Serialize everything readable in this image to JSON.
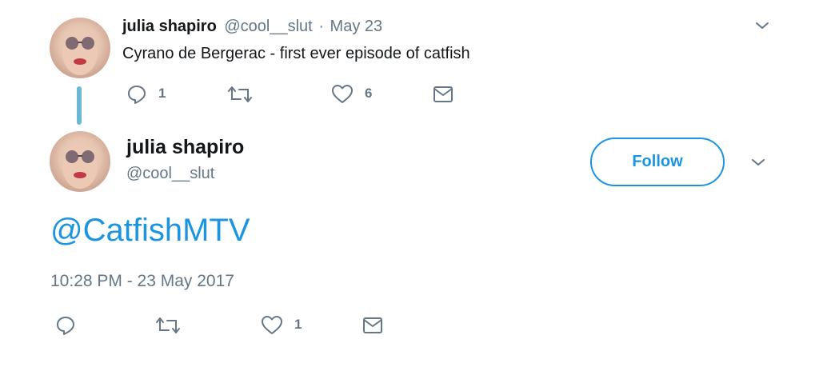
{
  "reply_tweet": {
    "author_name": "julia shapiro",
    "handle": "@cool__slut",
    "separator": "·",
    "date": "May 23",
    "text": "Cyrano de Bergerac - first ever episode of catfish",
    "reply_count": "1",
    "like_count": "6",
    "icons": [
      "reply-icon",
      "retweet-icon",
      "heart-icon",
      "message-icon",
      "chevron-down-icon"
    ]
  },
  "main_tweet": {
    "author_name": "julia shapiro",
    "handle": "@cool__slut",
    "follow_label": "Follow",
    "text": "@CatfishMTV",
    "timestamp": "10:28 PM - 23 May 2017",
    "like_count": "1",
    "icons": [
      "reply-icon",
      "retweet-icon",
      "heart-icon",
      "message-icon",
      "chevron-down-icon"
    ]
  },
  "colors": {
    "accent": "#1b95e0",
    "thread_line": "#6cb8d2",
    "muted_text": "#657786",
    "icon": "#657786"
  }
}
